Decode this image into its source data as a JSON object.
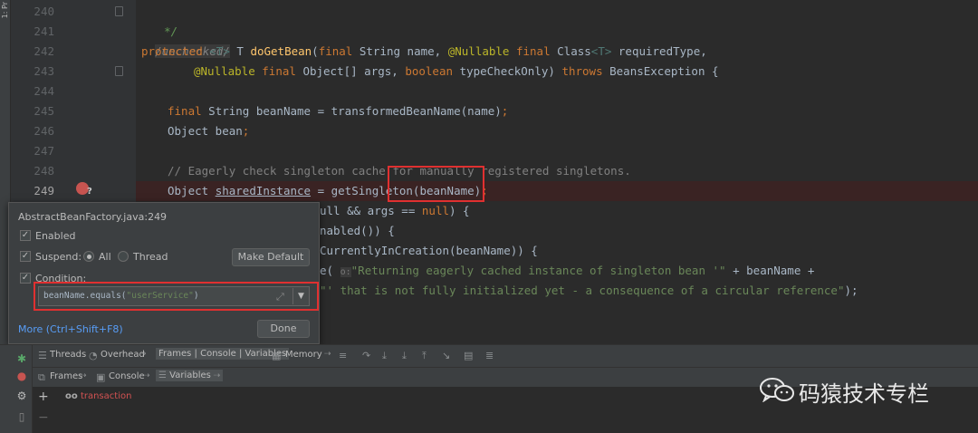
{
  "project_strip": {
    "label": "1: Pr"
  },
  "gutter": {
    "line_numbers": [
      "240",
      "241",
      "242",
      "243",
      "244",
      "245",
      "246",
      "247",
      "248",
      "249"
    ]
  },
  "code": {
    "line240": "*/",
    "line241_unchecked": "/unchecked/",
    "line242": {
      "kw1": "protected",
      "tp1": "<T>",
      "t": "T",
      "fn": "doGetBean",
      "p1": "(",
      "kw2": "final",
      "rest1": "String name,",
      "ann1": "@Nullable",
      "kw3": "final",
      "rest2": "Class",
      "tp2": "<T>",
      "rest3": "requiredType,"
    },
    "line243": {
      "ann": "@Nullable",
      "kw1": "final",
      "rest1": "Object[] args,",
      "kw2": "boolean",
      "rest2": "typeCheckOnly)",
      "kw3": "throws",
      "rest3": "BeansException {"
    },
    "line245": {
      "kw": "final",
      "rest": "String beanName = transformedBeanName(name)",
      "semi": ";"
    },
    "line246": {
      "rest": "Object bean",
      "semi": ";"
    },
    "line248_comment": "// Eagerly check singleton cache for manually registered singletons.",
    "line249": {
      "a": "Object ",
      "var": "sharedInstance",
      "b": " = getSingleton(beanName)",
      "semi": ";"
    },
    "line250_tail": {
      "a": "ull && args == ",
      "kw": "null",
      "b": ") {"
    },
    "line251_tail": "nabled()) {",
    "line252_tail": "CurrentlyInCreation(beanName)) {",
    "line253_tail": {
      "a": "e(",
      "hint": "o:",
      "str": "\"Returning eagerly cached instance of singleton bean '\"",
      "b": " + beanName +"
    },
    "line254_tail": {
      "str": "\"' that is not fully initialized yet - a consequence of a circular reference\"",
      "b": ");"
    }
  },
  "popup": {
    "title": "AbstractBeanFactory.java:249",
    "enabled_label": "Enabled",
    "suspend_label": "Suspend:",
    "all_label": "All",
    "thread_label": "Thread",
    "make_default_label": "Make Default",
    "condition_label": "Condition:",
    "condition_value_a": "beanName.equals(",
    "condition_value_str": "\"userService\"",
    "condition_value_b": ")",
    "more_link": "More (Ctrl+Shift+F8)",
    "done_label": "Done"
  },
  "debug": {
    "tabs": [
      "Threads",
      "Overhead",
      "Frames | Console | Variables",
      "Memory"
    ],
    "sub_tabs": [
      "Frames",
      "Console",
      "Variables"
    ],
    "watch_icon": "oo",
    "watch_label": "transaction"
  },
  "watermark": {
    "text": "码猿技术专栏"
  },
  "colors": {
    "editor_bg": "#2b2b2b",
    "keyword": "#cc7832",
    "annotation": "#bbb529",
    "function": "#ffc66d",
    "string": "#6a8759",
    "breakpoint": "#c75450",
    "highlight_box": "#e03030",
    "link": "#589df6"
  }
}
